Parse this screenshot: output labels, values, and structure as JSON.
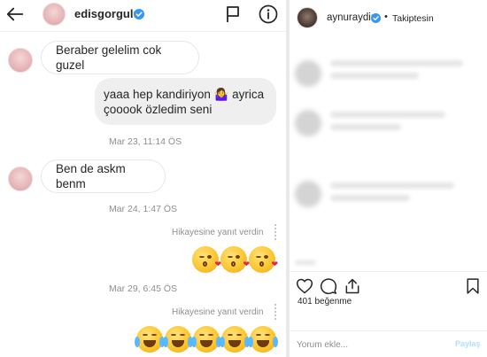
{
  "dm": {
    "header": {
      "username": "edisgorgulu"
    },
    "messages": {
      "m1": "Beraber gelelim cok guzel",
      "m2_line1": "yaaa hep kandiriyon 🤷‍♀️ ayrica",
      "m2_line2": "çooook özledim seni",
      "ts1": "Mar 23, 11:14 ÖS",
      "m3": "Ben de askm benm",
      "ts2": "Mar 24, 1:47 ÖS",
      "reply1": "Hikayesine yanıt verdin",
      "ts3": "Mar 29, 6:45 ÖS",
      "reply2": "Hikayesine yanıt verdin"
    }
  },
  "post": {
    "username": "aynuraydin",
    "dot": "•",
    "follow_status": "Takiptesin",
    "likes": "401 beğenme",
    "comment_placeholder": "Yorum ekle...",
    "share_label": "Paylaş"
  },
  "colors": {
    "verified": "#3897f0",
    "link": "#b2dffc"
  },
  "icons": [
    "back-arrow-icon",
    "verified-icon",
    "flag-icon",
    "info-icon",
    "heart-icon",
    "comment-icon",
    "share-icon",
    "bookmark-icon",
    "kiss-emoji",
    "laughing-tears-emoji"
  ]
}
